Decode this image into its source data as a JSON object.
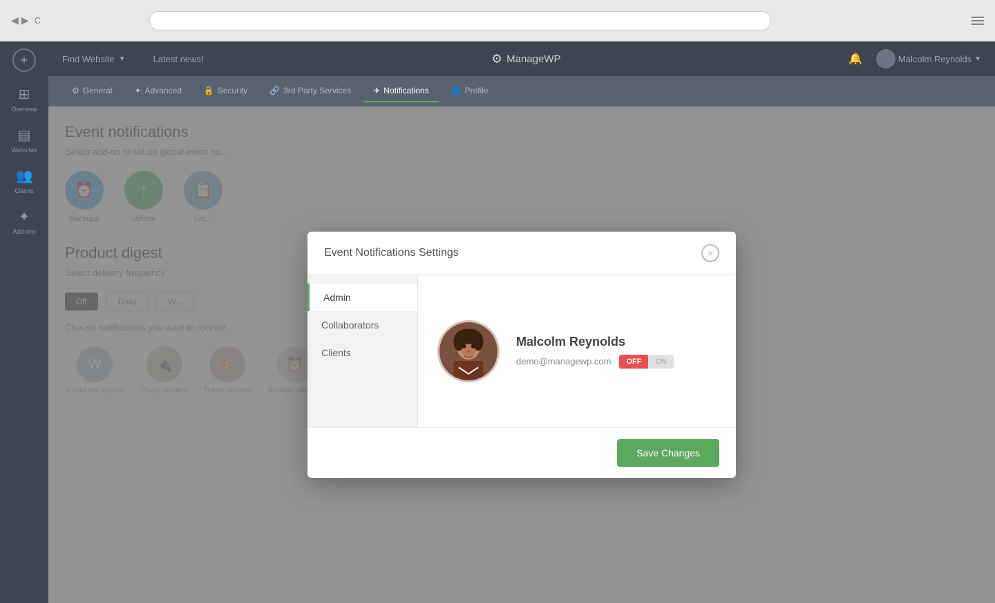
{
  "browser": {
    "nav_back": "◀",
    "nav_forward": "▶",
    "refresh": "C"
  },
  "topbar": {
    "find_website": "Find Website",
    "latest_news": "Latest news!",
    "logo_text": "ManageWP",
    "user_name": "Malcolm Reynolds"
  },
  "sidebar": {
    "items": [
      {
        "id": "overview",
        "label": "Overview",
        "icon": "⊞"
      },
      {
        "id": "websites",
        "label": "Websites",
        "icon": "⊟"
      },
      {
        "id": "clients",
        "label": "Clients",
        "icon": "👥"
      },
      {
        "id": "add-ons",
        "label": "Add-ons",
        "icon": "✦"
      }
    ]
  },
  "tabs": [
    {
      "id": "general",
      "label": "General",
      "icon": "⚙",
      "active": false
    },
    {
      "id": "advanced",
      "label": "Advanced",
      "icon": "✦",
      "active": false
    },
    {
      "id": "security",
      "label": "Security",
      "icon": "🔒",
      "active": false
    },
    {
      "id": "3rd-party",
      "label": "3rd Party Services",
      "icon": "🔗",
      "active": false
    },
    {
      "id": "notifications",
      "label": "Notifications",
      "icon": "✈",
      "active": true
    },
    {
      "id": "profile",
      "label": "Profile",
      "icon": "👤",
      "active": false
    }
  ],
  "page": {
    "event_title": "Event notifications",
    "event_sub": "Select add-on to set up global event no...",
    "product_title": "Product digest",
    "delivery_label": "Select delivery frequency",
    "delivery_options": [
      "Off",
      "Daily",
      "W..."
    ],
    "notifications_label": "Choose notifications you want to receive"
  },
  "modal": {
    "title": "Event Notifications Settings",
    "close_icon": "×",
    "nav_items": [
      {
        "id": "admin",
        "label": "Admin",
        "active": true
      },
      {
        "id": "collaborators",
        "label": "Collaborators",
        "active": false
      },
      {
        "id": "clients",
        "label": "Clients",
        "active": false
      }
    ],
    "user": {
      "name": "Malcolm Reynolds",
      "email": "demo@managewp.com",
      "toggle_off": "OFF",
      "toggle_on": "ON"
    },
    "save_label": "Save Changes"
  }
}
